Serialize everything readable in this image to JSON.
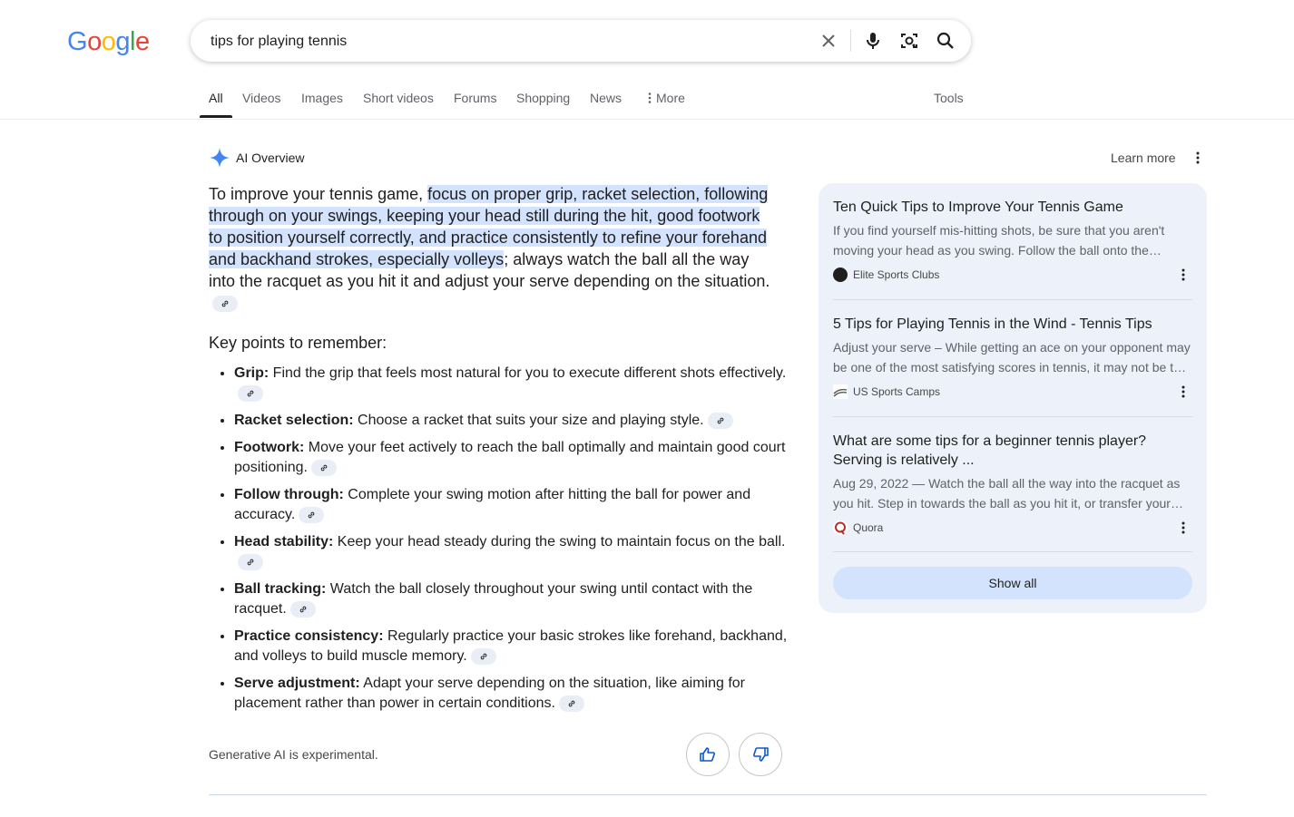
{
  "logo": {
    "letters": [
      "G",
      "o",
      "o",
      "g",
      "l",
      "e"
    ],
    "colors": [
      "#4285f4",
      "#ea4335",
      "#fbbc05",
      "#4285f4",
      "#34a853",
      "#ea4335"
    ]
  },
  "search": {
    "query": "tips for playing tennis"
  },
  "tabs": [
    {
      "label": "All"
    },
    {
      "label": "Videos"
    },
    {
      "label": "Images"
    },
    {
      "label": "Short videos"
    },
    {
      "label": "Forums"
    },
    {
      "label": "Shopping"
    },
    {
      "label": "News"
    },
    {
      "label": "More"
    }
  ],
  "tools_label": "Tools",
  "ai_overview": {
    "title": "AI Overview",
    "learn_more": "Learn more",
    "summary_prefix": "To improve your tennis game, ",
    "summary_highlight": "focus on proper grip, racket selection, following through on your swings, keeping your head still during the hit, good footwork to position yourself correctly, and practice consistently to refine your forehand and backhand strokes, especially volleys",
    "summary_suffix": "; always watch the ball all the way into the racquet as you hit it and adjust your serve depending on the situation.",
    "key_points_title": "Key points to remember:",
    "key_points": [
      {
        "term": "Grip:",
        "text": " Find the grip that feels most natural for you to execute different shots effectively."
      },
      {
        "term": "Racket selection:",
        "text": " Choose a racket that suits your size and playing style."
      },
      {
        "term": "Footwork:",
        "text": " Move your feet actively to reach the ball optimally and maintain good court positioning."
      },
      {
        "term": "Follow through:",
        "text": " Complete your swing motion after hitting the ball for power and accuracy."
      },
      {
        "term": "Head stability:",
        "text": " Keep your head steady during the swing to maintain focus on the ball."
      },
      {
        "term": "Ball tracking:",
        "text": " Watch the ball closely throughout your swing until contact with the racquet."
      },
      {
        "term": "Practice consistency:",
        "text": " Regularly practice your basic strokes like forehand, backhand, and volleys to build muscle memory."
      },
      {
        "term": "Serve adjustment:",
        "text": " Adapt your serve depending on the situation, like aiming for placement rather than power in certain conditions."
      }
    ],
    "disclaimer": "Generative AI is experimental."
  },
  "sources": [
    {
      "title": "Ten Quick Tips to Improve Your Tennis Game",
      "desc": "If you find yourself mis-hitting shots, be sure that you aren't moving your head as you swing. Follow the ball onto the…",
      "source": "Elite Sports Clubs",
      "favicon_color": "#1f1f1f"
    },
    {
      "title": "5 Tips for Playing Tennis in the Wind - Tennis Tips",
      "desc": "Adjust your serve – While getting an ace on your opponent may be one of the most satisfying scores in tennis, it may not be t…",
      "source": "US Sports Camps",
      "favicon_color": "#5f6368"
    },
    {
      "title": "What are some tips for a beginner tennis player? Serving is relatively ...",
      "desc": "Aug 29, 2022 — Watch the ball all the way into the racquet as you hit. Step in towards the ball as you hit it, or transfer your…",
      "source": "Quora",
      "favicon_color": "#b92b27"
    }
  ],
  "show_all": "Show all"
}
